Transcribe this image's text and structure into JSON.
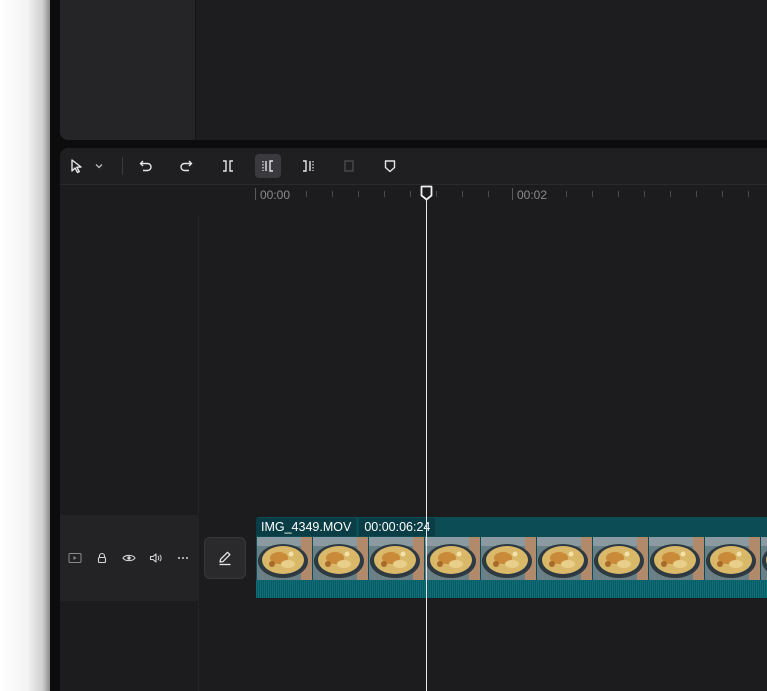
{
  "ruler": {
    "labels": [
      "00:00",
      "00:02"
    ]
  },
  "toolbar": {
    "tools": [
      "select-pointer-icon",
      "chevron-down-icon",
      "undo-icon",
      "redo-icon",
      "split-icon",
      "split-left-icon",
      "split-right-icon",
      "delete-icon",
      "marker-icon"
    ],
    "active_tool": "split-left-icon"
  },
  "track": {
    "icons": [
      "track-video-icon",
      "lock-icon",
      "eye-icon",
      "volume-icon",
      "more-icon"
    ]
  },
  "clip": {
    "name": "IMG_4349.MOV",
    "duration": "00:00:06:24",
    "thumbnail_count": 10
  },
  "colors": {
    "clip_bg": "#0b4c55",
    "panel_bg": "#1c1c1e",
    "playhead": "#e8e8ea"
  }
}
